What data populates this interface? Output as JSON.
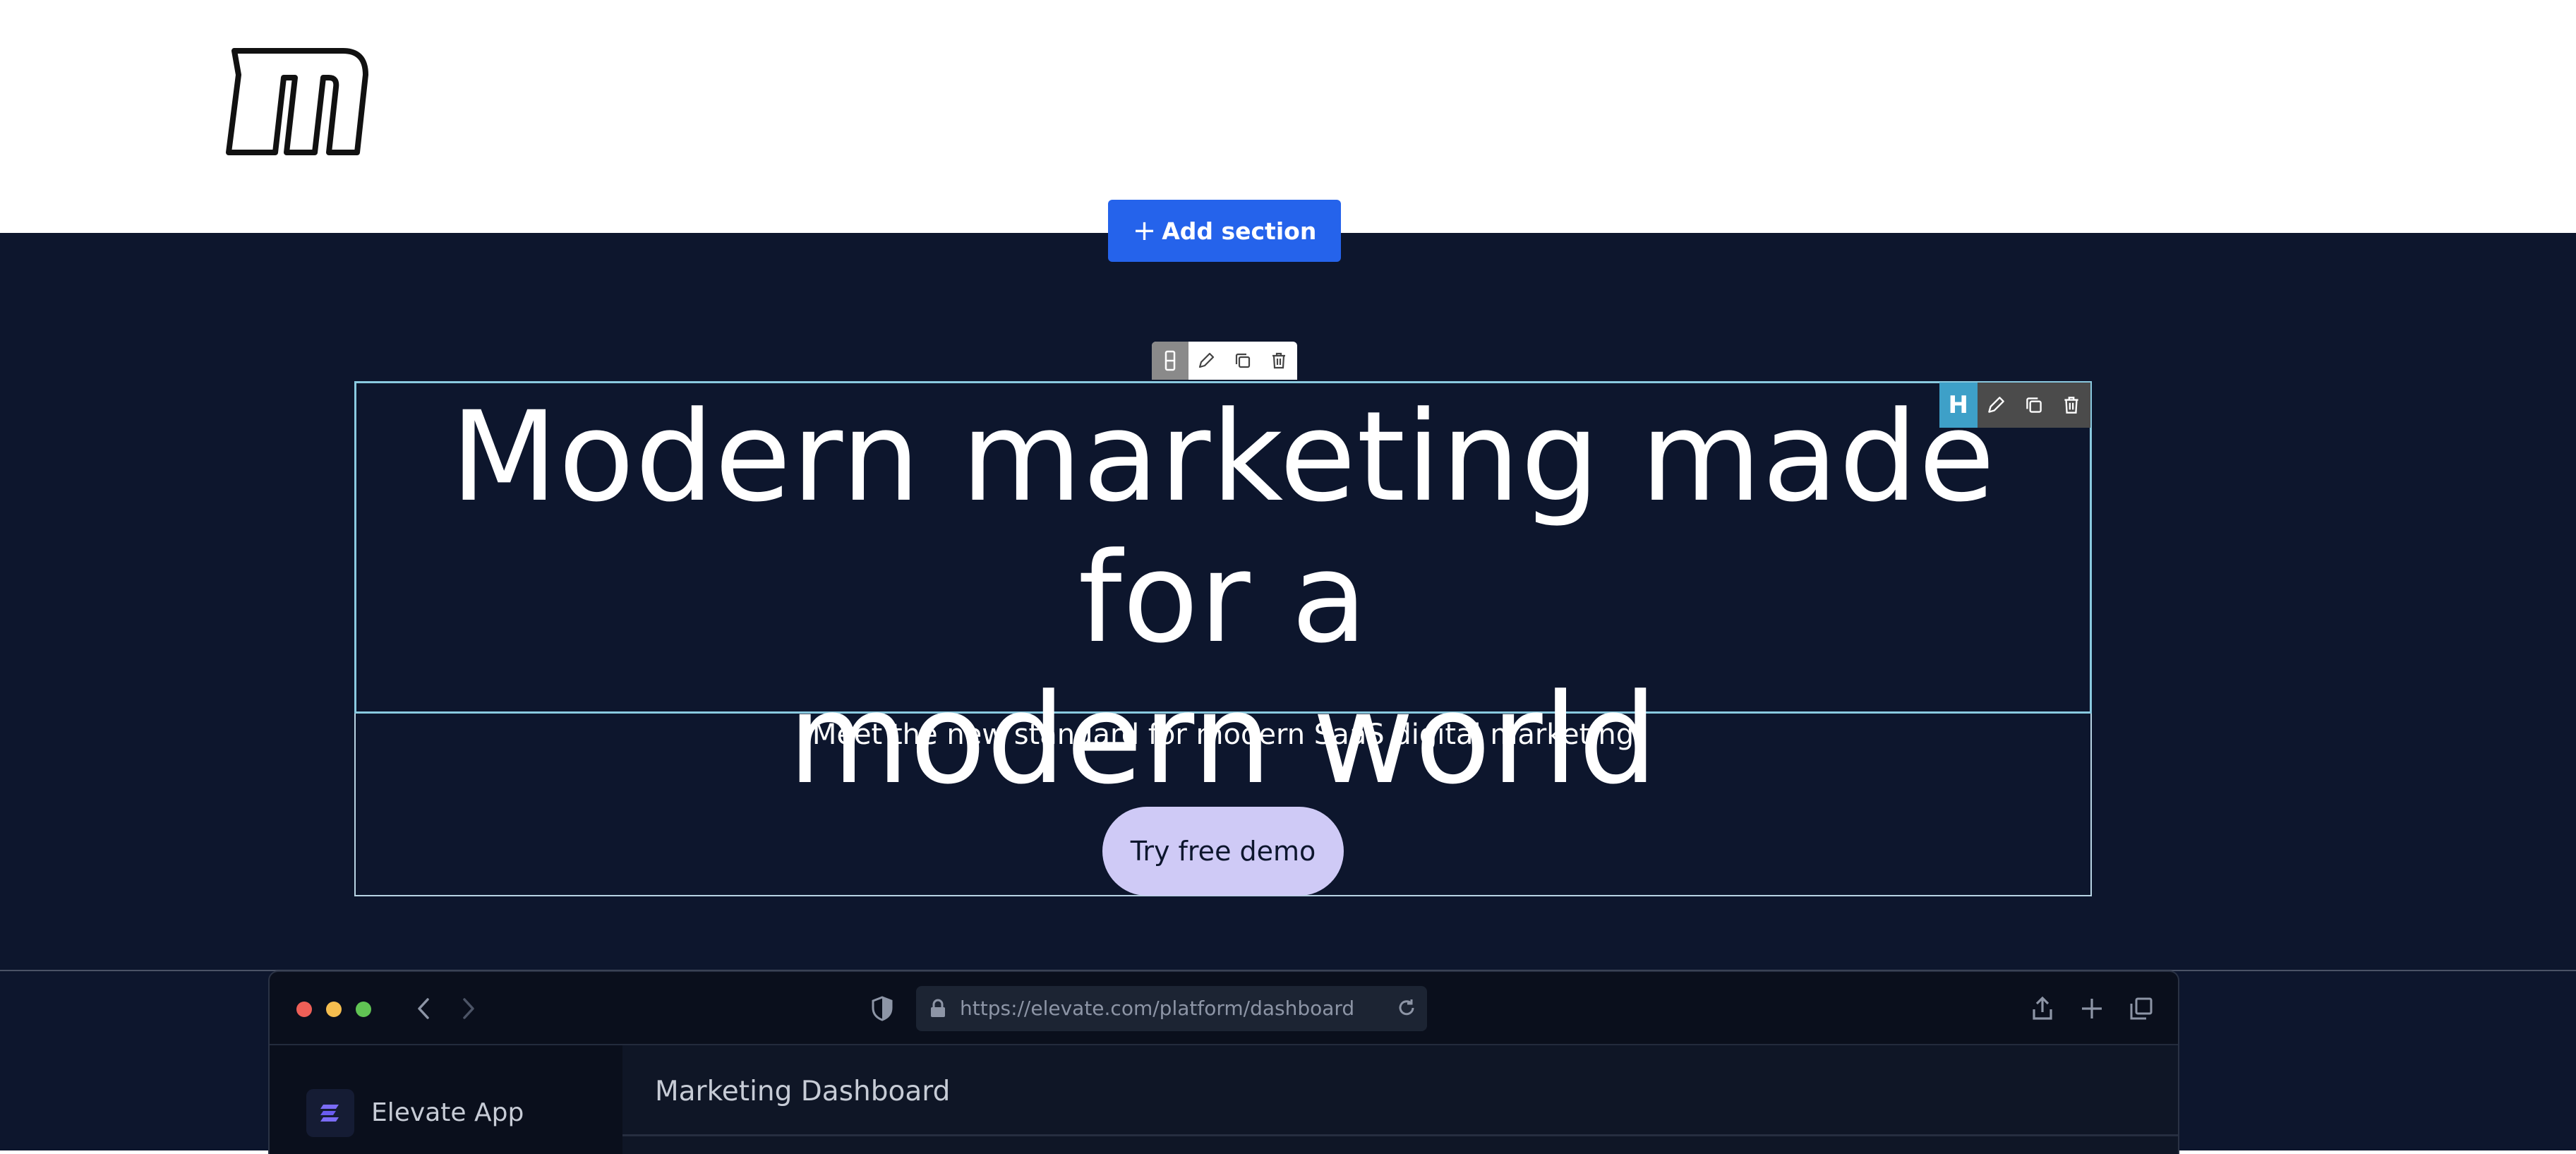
{
  "header": {
    "logo_icon": "m-logo-icon"
  },
  "editor": {
    "add_section_label": "Add section",
    "add_section_icon": "plus-icon",
    "accent_color": "#2563eb",
    "block_toolbar_icons": [
      "drag-handle-icon",
      "pencil-icon",
      "duplicate-icon",
      "trash-icon"
    ],
    "heading_toolbar": {
      "badge": "H",
      "icons": [
        "pencil-icon",
        "duplicate-icon",
        "trash-icon"
      ]
    },
    "selection_color": "#89c9df"
  },
  "hero": {
    "background": "#0d162d",
    "headline_line1": "Modern marketing made for a",
    "headline_line2": "modern world",
    "subtitle": "Meet the new standard for modern SaaS digital marketing",
    "cta_label": "Try free demo",
    "cta_color": "#cfcaf6"
  },
  "browser": {
    "url": "https://elevate.com/platform/dashboard",
    "icons": [
      "back-arrow-icon",
      "forward-arrow-icon",
      "shield-icon",
      "lock-icon",
      "reload-icon",
      "share-icon",
      "new-tab-icon",
      "tabs-icon"
    ],
    "app": {
      "name": "Elevate App",
      "page_title": "Marketing Dashboard"
    }
  }
}
